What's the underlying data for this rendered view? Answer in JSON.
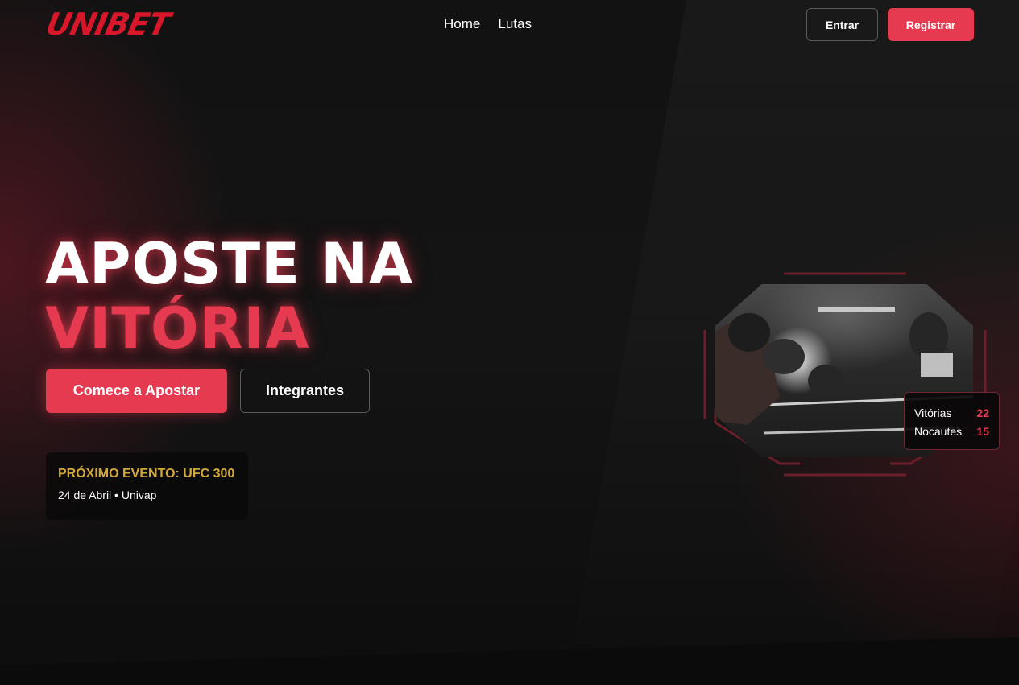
{
  "header": {
    "logo": "UNIBET",
    "nav": [
      {
        "label": "Home"
      },
      {
        "label": "Lutas"
      }
    ],
    "login_label": "Entrar",
    "register_label": "Registrar"
  },
  "hero": {
    "title_line1": "APOSTE NA",
    "title_line2": "VITÓRIA",
    "cta_primary": "Comece a Apostar",
    "cta_secondary": "Integrantes"
  },
  "event": {
    "title": "PRÓXIMO EVENTO: UFC 300",
    "subtitle": "24 de Abril • Univap"
  },
  "stats": [
    {
      "label": "Vitórias",
      "value": "22"
    },
    {
      "label": "Nocautes",
      "value": "15"
    }
  ],
  "colors": {
    "accent": "#e63a50",
    "logo": "#d8172b",
    "event_gold": "#d4a838",
    "background": "#121212"
  },
  "icons": {
    "fighter_image": "boxing-fighters-photo"
  }
}
